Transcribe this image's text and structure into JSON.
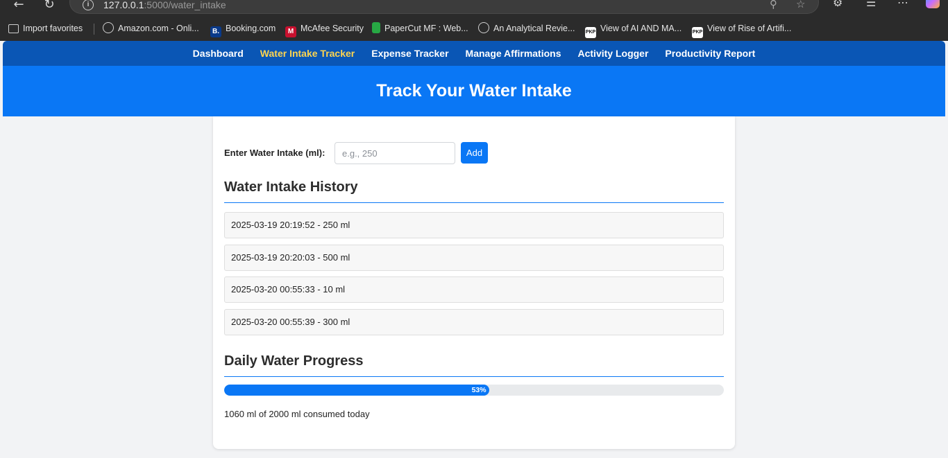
{
  "browser": {
    "url_host": "127.0.0.1",
    "url_path": ":5000/water_intake",
    "bookmarks": [
      {
        "label": "Import favorites",
        "icon": "folder-import-icon"
      },
      {
        "label": "Amazon.com - Onli...",
        "icon": "globe-icon"
      },
      {
        "label": "Booking.com",
        "icon": "booking-icon",
        "icon_text": "B."
      },
      {
        "label": "McAfee Security",
        "icon": "mcafee-icon"
      },
      {
        "label": "PaperCut MF : Web...",
        "icon": "papercut-icon"
      },
      {
        "label": "An Analytical Revie...",
        "icon": "globe-icon"
      },
      {
        "label": "View of AI AND MA...",
        "icon": "pkp-icon",
        "icon_text": "PKP"
      },
      {
        "label": "View of Rise of Artifi...",
        "icon": "pkp-icon",
        "icon_text": "PKP"
      }
    ]
  },
  "nav": {
    "items": [
      {
        "label": "Dashboard"
      },
      {
        "label": "Water Intake Tracker",
        "active": true
      },
      {
        "label": "Expense Tracker"
      },
      {
        "label": "Manage Affirmations"
      },
      {
        "label": "Activity Logger"
      },
      {
        "label": "Productivity Report"
      }
    ]
  },
  "header": {
    "title": "Track Your Water Intake"
  },
  "form": {
    "label": "Enter Water Intake (ml):",
    "placeholder": "e.g., 250",
    "value": "",
    "button_label": "Add"
  },
  "history": {
    "title": "Water Intake History",
    "entries": [
      "2025-03-19 20:19:52 - 250 ml",
      "2025-03-19 20:20:03 - 500 ml",
      "2025-03-20 00:55:33 - 10 ml",
      "2025-03-20 00:55:39 - 300 ml"
    ]
  },
  "progress": {
    "title": "Daily Water Progress",
    "percent": 53,
    "percent_label": "53%",
    "summary": "1060 ml of 2000 ml consumed today"
  },
  "colors": {
    "nav_bg": "#0a56b5",
    "nav_active": "#ffd54f",
    "accent": "#0a77f5"
  }
}
